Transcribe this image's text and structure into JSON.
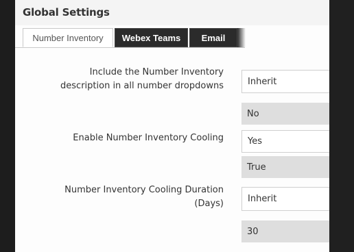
{
  "title": "Global Settings",
  "tabs": [
    {
      "label": "Number Inventory",
      "active": true
    },
    {
      "label": "Webex Teams",
      "active": false
    },
    {
      "label": "Email",
      "active": false
    }
  ],
  "settings": [
    {
      "label_lines": [
        "Include the Number Inventory",
        "description in all number dropdowns"
      ],
      "select_value": "Inherit",
      "inherited_value": "No"
    },
    {
      "label_lines": [
        "Enable Number Inventory Cooling"
      ],
      "select_value": "Yes",
      "inherited_value": "True"
    },
    {
      "label_lines": [
        "Number Inventory Cooling Duration",
        "(Days)"
      ],
      "select_value": "Inherit",
      "inherited_value": "30"
    }
  ]
}
